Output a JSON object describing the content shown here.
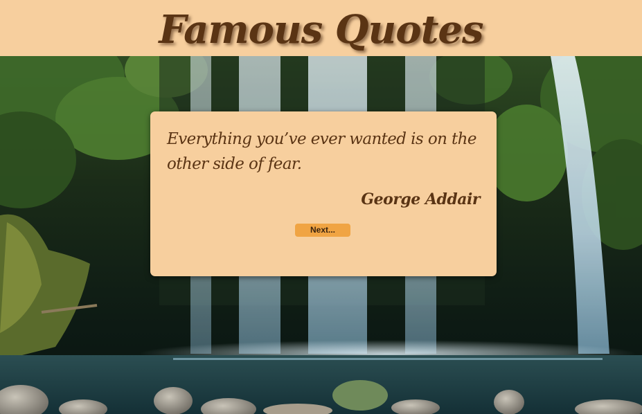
{
  "header": {
    "title": "Famous Quotes"
  },
  "quote": {
    "text": "Everything you’ve ever wanted is on the other side of fear.",
    "author": "George Addair"
  },
  "controls": {
    "next_label": "Next..."
  },
  "colors": {
    "header_bg": "#f7cf9e",
    "card_bg": "#f7cf9e",
    "text": "#5a3414",
    "button": "#f0a443"
  },
  "background": {
    "scene": "waterfall-forest"
  }
}
